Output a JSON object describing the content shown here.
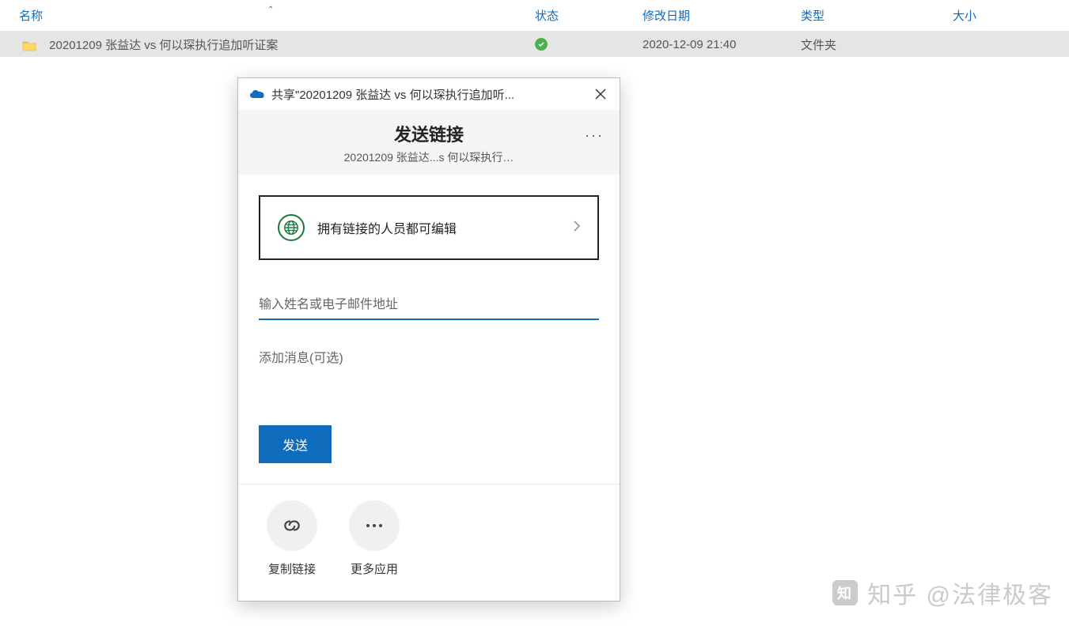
{
  "explorer": {
    "columns": {
      "name": "名称",
      "status": "状态",
      "date": "修改日期",
      "type": "类型",
      "size": "大小"
    },
    "row": {
      "name": "20201209 张益达 vs 何以琛执行追加听证案",
      "date": "2020-12-09 21:40",
      "type": "文件夹",
      "size": ""
    }
  },
  "dialog": {
    "titlebar": "共享\"20201209 张益达 vs 何以琛执行追加听...",
    "heading": "发送链接",
    "subtitle": "20201209 张益达...s 何以琛执行…",
    "link_setting": "拥有链接的人员都可编辑",
    "name_placeholder": "输入姓名或电子邮件地址",
    "message_placeholder": "添加消息(可选)",
    "send_label": "发送",
    "copy_link_label": "复制链接",
    "more_apps_label": "更多应用"
  },
  "watermark": "知乎 @法律极客"
}
